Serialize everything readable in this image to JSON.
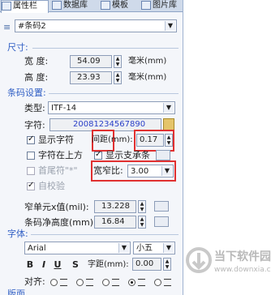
{
  "tabs": [
    {
      "label": "属性栏",
      "active": true
    },
    {
      "label": "数据库",
      "active": false
    },
    {
      "label": "模板",
      "active": false
    },
    {
      "label": "图片库",
      "active": false
    }
  ],
  "object_select": {
    "value": "#条码2"
  },
  "size": {
    "section": "尺寸:",
    "width_label": "宽    度:",
    "width_value": "54.09",
    "height_label": "高    度:",
    "height_value": "23.93",
    "unit": "毫米(mm)"
  },
  "barcode": {
    "section": "条码设置:",
    "type_label": "类型:",
    "type_value": "ITF-14",
    "chars_label": "字符:",
    "chars_value": "20081234567890",
    "show_chars_label": "显示字符",
    "show_chars_checked": true,
    "spacing_label": "间距(mm):",
    "spacing_value": "0.17",
    "chars_above_label": "字符在上方",
    "chars_above_checked": false,
    "show_bearer_label": "显示支承条",
    "show_bearer_checked": true,
    "head_tail_label": "首尾符\"*\"",
    "head_tail_checked": false,
    "ratio_label": "宽窄比:",
    "ratio_value": "3.00",
    "auto_check_label": "自校验",
    "auto_check_checked": true,
    "narrow_x_label": "窄单元x值(mil):",
    "narrow_x_value": "13.228",
    "quiet_zone_label": "条码净高度(mm):",
    "quiet_zone_value": "16.84"
  },
  "font": {
    "section": "字体:",
    "family": "Arial",
    "size": "小五",
    "bold": "B",
    "italic": "I",
    "underline": "U",
    "strike": "S",
    "spacing_label": "字距(mm):",
    "spacing_value": "0.00",
    "align_label": "对齐:",
    "align_selected": 3
  },
  "next_section": "版面",
  "watermark": {
    "title": "当下软件园",
    "url": "www.downxia.com"
  },
  "colors": {
    "highlight": "#e03030",
    "section": "#2f5ec4"
  }
}
